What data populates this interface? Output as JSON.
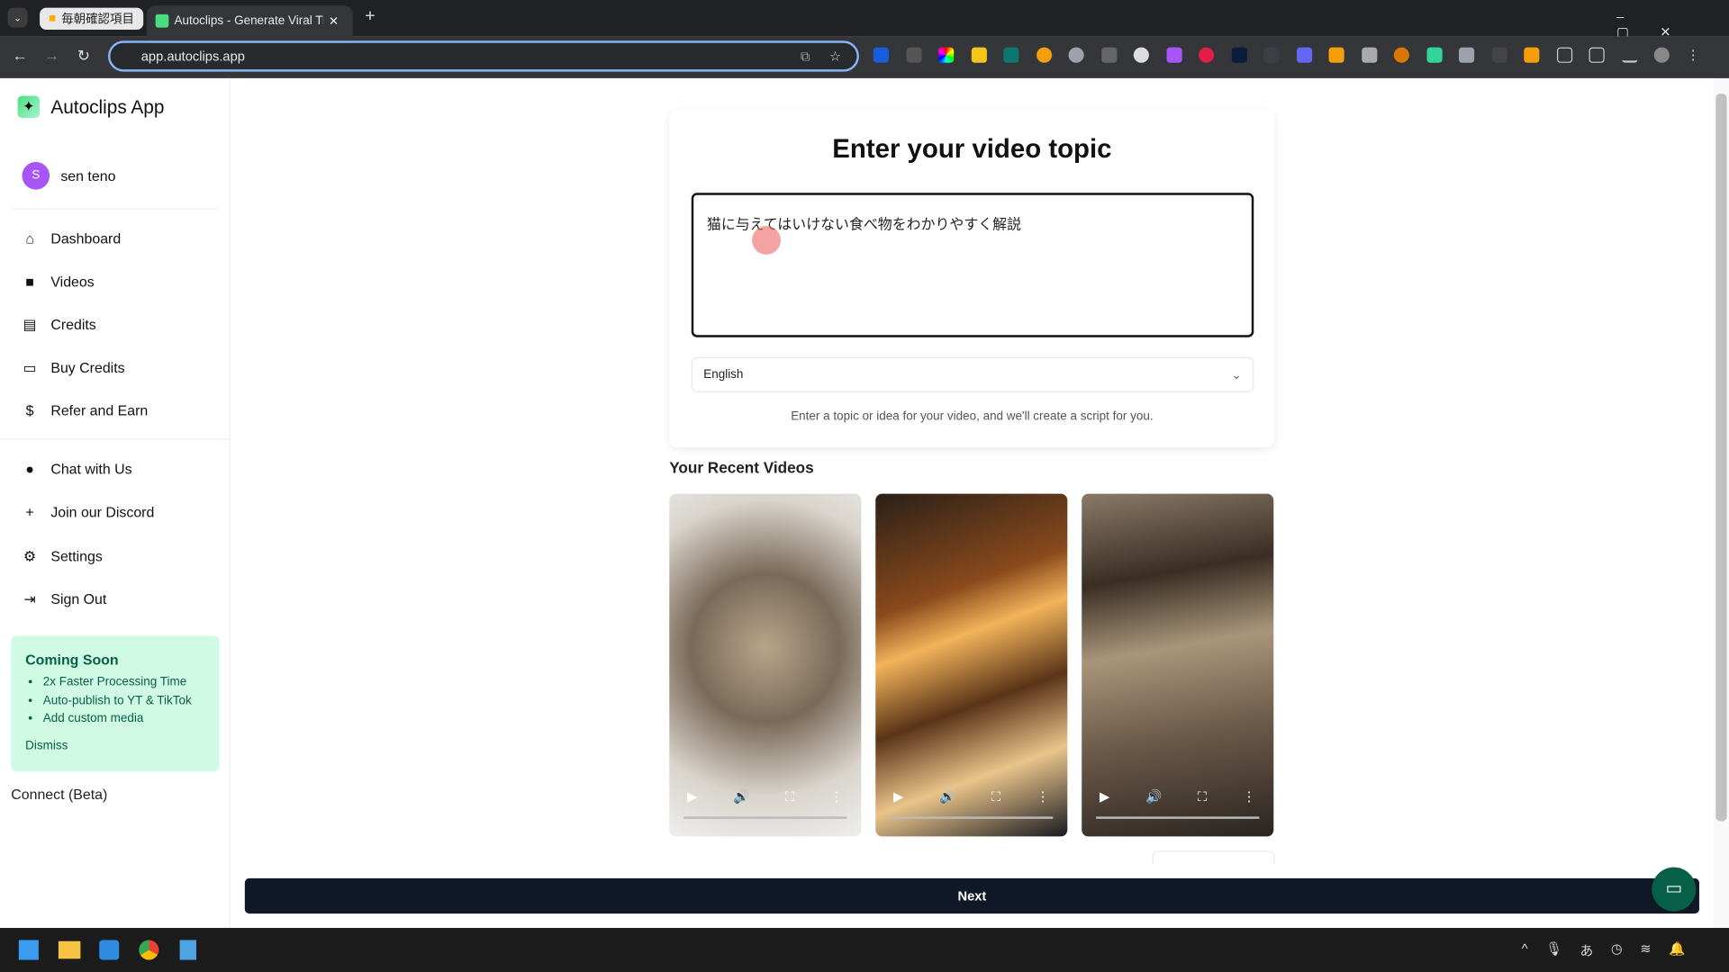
{
  "browser": {
    "tabs": [
      {
        "label": "毎朝確認項目"
      },
      {
        "label": "Autoclips - Generate Viral TikTo"
      }
    ],
    "url": "app.autoclips.app"
  },
  "sidebar": {
    "app_name": "Autoclips App",
    "user": {
      "initial": "S",
      "name": "sen teno",
      "avatar_color": "#a855f7"
    },
    "items": [
      {
        "label": "Dashboard",
        "icon": "home-icon"
      },
      {
        "label": "Videos",
        "icon": "video-icon"
      },
      {
        "label": "Credits",
        "icon": "receipt-icon"
      },
      {
        "label": "Buy Credits",
        "icon": "credit-card-icon"
      },
      {
        "label": "Refer and Earn",
        "icon": "dollar-icon"
      },
      {
        "label": "Chat with Us",
        "icon": "chat-icon"
      },
      {
        "label": "Join our Discord",
        "icon": "plus-icon"
      },
      {
        "label": "Settings",
        "icon": "gear-icon"
      },
      {
        "label": "Sign Out",
        "icon": "sign-out-icon"
      }
    ],
    "coming_soon": {
      "title": "Coming Soon",
      "items": [
        "2x Faster Processing Time",
        "Auto-publish to YT & TikTok",
        "Add custom media"
      ],
      "dismiss": "Dismiss"
    },
    "connect": "Connect (Beta)"
  },
  "main": {
    "title": "Enter your video topic",
    "topic_value": "猫に与えてはいけない食べ物をわかりやすく解説",
    "language": "English",
    "hint": "Enter a topic or idea for your video, and we'll create a script for you.",
    "recent_title": "Your Recent Videos",
    "next": "Next"
  },
  "colors": {
    "accent": "#111827",
    "chat_bubble": "#065f46",
    "coming_soon_bg": "#d1fae5"
  }
}
